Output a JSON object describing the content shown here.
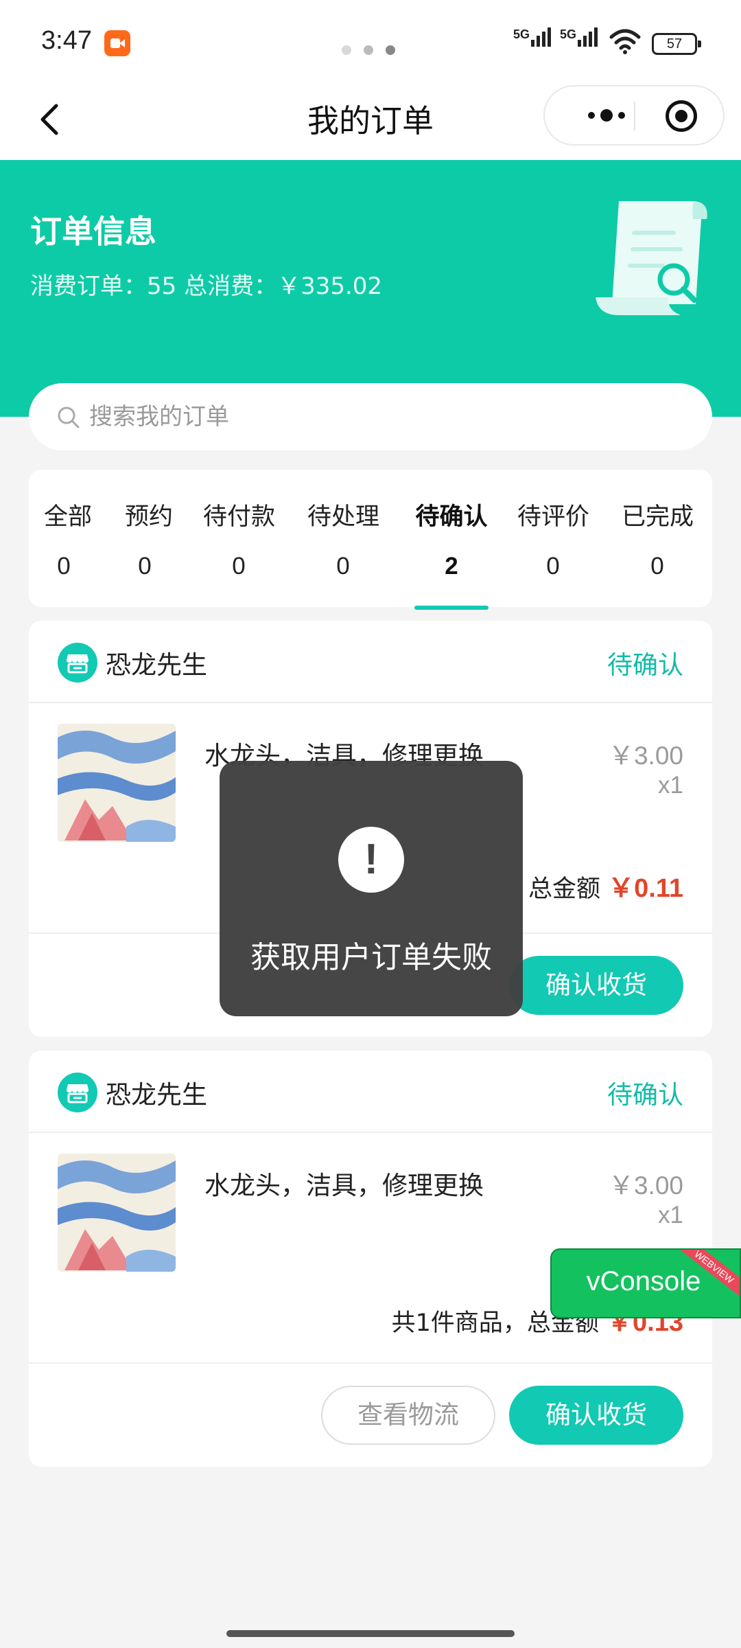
{
  "status_bar": {
    "time": "3:47",
    "network_1": "5G",
    "network_2": "5G",
    "battery": "57"
  },
  "nav": {
    "title": "我的订单",
    "back_icon": "chevron-left-icon",
    "more_icon": "more-dots-icon",
    "close_icon": "target-circle-icon"
  },
  "banner": {
    "title": "订单信息",
    "summary": "消费订单：55 总消费：￥335.02",
    "bg_color": "#0ecba7"
  },
  "search": {
    "placeholder": "搜索我的订单"
  },
  "tabs": [
    {
      "label": "全部",
      "count": "0"
    },
    {
      "label": "预约",
      "count": "0"
    },
    {
      "label": "待付款",
      "count": "0"
    },
    {
      "label": "待处理",
      "count": "0"
    },
    {
      "label": "待确认",
      "count": "2",
      "active": true
    },
    {
      "label": "待评价",
      "count": "0"
    },
    {
      "label": "已完成",
      "count": "0"
    }
  ],
  "orders": [
    {
      "store": "恐龙先生",
      "status": "待确认",
      "item_name": "水龙头，洁具，修理更换",
      "price": "￥3.00",
      "qty": "x1",
      "total_label": "总金额",
      "total_amount": "￥0.11",
      "confirm_label": "确认收货"
    },
    {
      "store": "恐龙先生",
      "status": "待确认",
      "item_name": "水龙头，洁具，修理更换",
      "price": "￥3.00",
      "qty": "x1",
      "total_label": "共1件商品，总金额",
      "total_amount": "￥0.13",
      "logistics_label": "查看物流",
      "confirm_label": "确认收货"
    }
  ],
  "toast": {
    "icon": "exclamation-icon",
    "message": "获取用户订单失败"
  },
  "vconsole": {
    "label": "vConsole",
    "tag": "WEBVIEW"
  },
  "colors": {
    "accent": "#12c9b3",
    "price_red": "#e2452a",
    "vconsole_green": "#14c15f"
  }
}
